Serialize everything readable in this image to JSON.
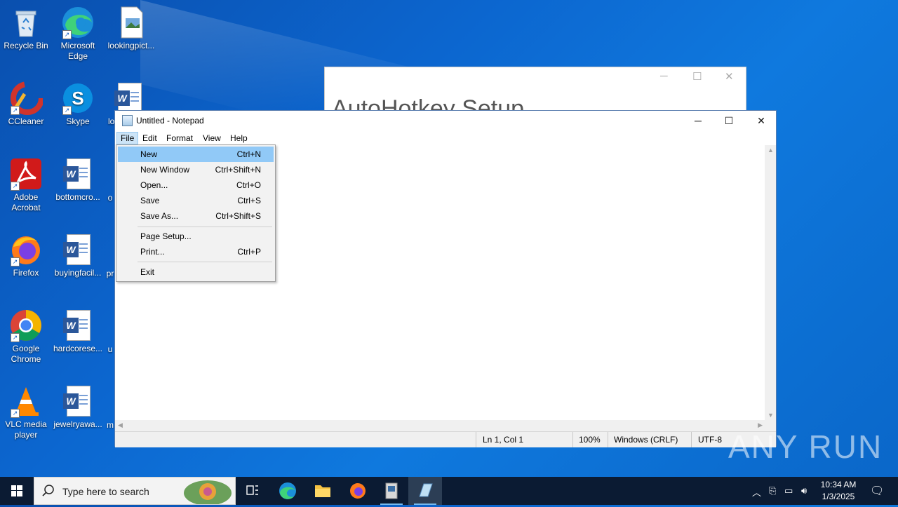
{
  "desktop": {
    "icons": [
      {
        "label": "Recycle Bin"
      },
      {
        "label": "Microsoft Edge"
      },
      {
        "label": "lookingpict..."
      },
      {
        "label": "CCleaner"
      },
      {
        "label": "Skype"
      },
      {
        "label": "lo"
      },
      {
        "label": "Adobe Acrobat"
      },
      {
        "label": "bottomcro..."
      },
      {
        "label": "o"
      },
      {
        "label": "Firefox"
      },
      {
        "label": "buyingfacil..."
      },
      {
        "label": "pr"
      },
      {
        "label": "Google Chrome"
      },
      {
        "label": "hardcorese..."
      },
      {
        "label": "u"
      },
      {
        "label": "VLC media player"
      },
      {
        "label": "jewelryawa..."
      },
      {
        "label": "m"
      }
    ]
  },
  "ahk_window": {
    "title": "AutoHotkey Setup"
  },
  "notepad": {
    "title": "Untitled - Notepad",
    "menus": [
      "File",
      "Edit",
      "Format",
      "View",
      "Help"
    ],
    "file_menu": {
      "items": [
        {
          "label": "New",
          "shortcut": "Ctrl+N"
        },
        {
          "label": "New Window",
          "shortcut": "Ctrl+Shift+N"
        },
        {
          "label": "Open...",
          "shortcut": "Ctrl+O"
        },
        {
          "label": "Save",
          "shortcut": "Ctrl+S"
        },
        {
          "label": "Save As...",
          "shortcut": "Ctrl+Shift+S"
        },
        {
          "label": "Page Setup...",
          "shortcut": ""
        },
        {
          "label": "Print...",
          "shortcut": "Ctrl+P"
        },
        {
          "label": "Exit",
          "shortcut": ""
        }
      ]
    },
    "status": {
      "position": "Ln 1, Col 1",
      "zoom": "100%",
      "line_ending": "Windows (CRLF)",
      "encoding": "UTF-8"
    }
  },
  "taskbar": {
    "search_placeholder": "Type here to search",
    "time": "10:34 AM",
    "date": "1/3/2025"
  },
  "watermark": "ANY RUN"
}
